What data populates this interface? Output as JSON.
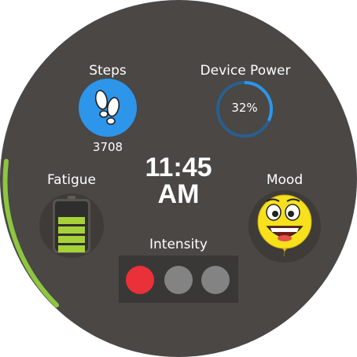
{
  "clock": {
    "time": "11:45",
    "ampm": "AM"
  },
  "steps": {
    "label": "Steps",
    "value": "3708",
    "icon": "footprints-icon"
  },
  "device_power": {
    "label": "Device Power",
    "value": "32%",
    "percent": 32,
    "color": "#2d95ea"
  },
  "fatigue": {
    "label": "Fatigue",
    "icon": "battery-icon",
    "filled_segments": 4,
    "total_segments": 4,
    "color": "#a6d13a"
  },
  "mood": {
    "label": "Mood",
    "icon": "smiley-face-icon",
    "color": "#f6e11c"
  },
  "intensity": {
    "label": "Intensity",
    "levels": [
      {
        "color": "#ea3039",
        "active": true
      },
      {
        "color": "#838383",
        "active": false
      },
      {
        "color": "#838383",
        "active": false
      }
    ]
  },
  "progress_arc": {
    "fraction": 0.18,
    "color": "#8dc63f"
  }
}
